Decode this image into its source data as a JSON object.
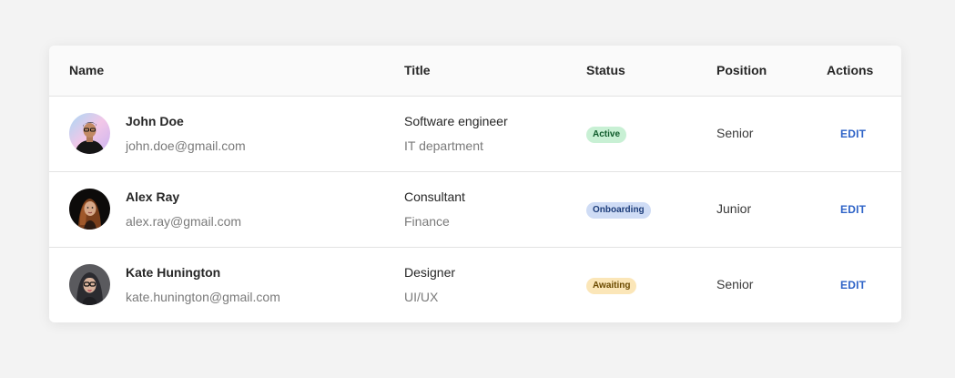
{
  "table": {
    "headers": {
      "name": "Name",
      "title": "Title",
      "status": "Status",
      "position": "Position",
      "actions": "Actions"
    },
    "rows": [
      {
        "name": "John Doe",
        "email": "john.doe@gmail.com",
        "title": "Software engineer",
        "department": "IT department",
        "status": "Active",
        "status_type": "active",
        "position": "Senior",
        "action": "EDIT",
        "avatar": "avatar-john-doe"
      },
      {
        "name": "Alex Ray",
        "email": "alex.ray@gmail.com",
        "title": "Consultant",
        "department": "Finance",
        "status": "Onboarding",
        "status_type": "onboarding",
        "position": "Junior",
        "action": "EDIT",
        "avatar": "avatar-alex-ray"
      },
      {
        "name": "Kate Hunington",
        "email": "kate.hunington@gmail.com",
        "title": "Designer",
        "department": "UI/UX",
        "status": "Awaiting",
        "status_type": "awaiting",
        "position": "Senior",
        "action": "EDIT",
        "avatar": "avatar-kate-hunington"
      }
    ]
  },
  "colors": {
    "page_background": "#f3f3f3",
    "link": "#2e63c7",
    "badge_active": "#c8f0d4",
    "badge_onboarding": "#cfdcf5",
    "badge_awaiting": "#fbe6b8"
  }
}
